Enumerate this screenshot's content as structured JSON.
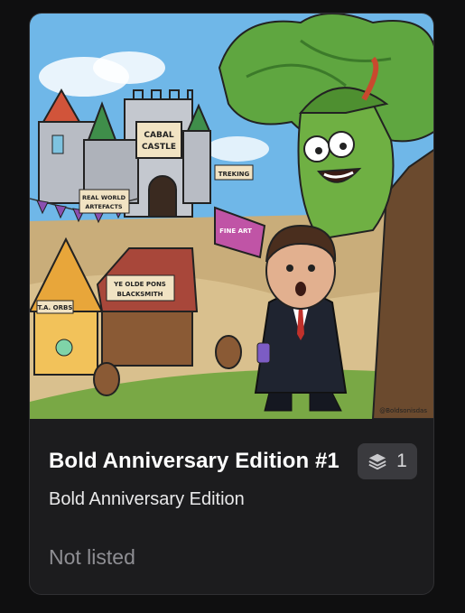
{
  "card": {
    "title": "Bold Anniversary Edition #1",
    "collection": "Bold Anniversary Edition",
    "edition_count": "1",
    "status": "Not listed",
    "edition_icon": "layers-icon"
  },
  "artwork": {
    "signs": {
      "castle": "CABAL CASTLE",
      "artifacts": "REAL WORLD ARTEFACTS",
      "trekking": "TREKING",
      "fine_art": "FINE ART",
      "blacksmith": "YE OLDE PONS BLACKSMITH",
      "orbs": "T.A. ORBS",
      "signature": "@Boldsonisdas"
    }
  },
  "colors": {
    "background": "#0f0f10",
    "card": "#1c1c1e",
    "badge": "#3a3a3e",
    "muted_text": "#8e8e93"
  }
}
